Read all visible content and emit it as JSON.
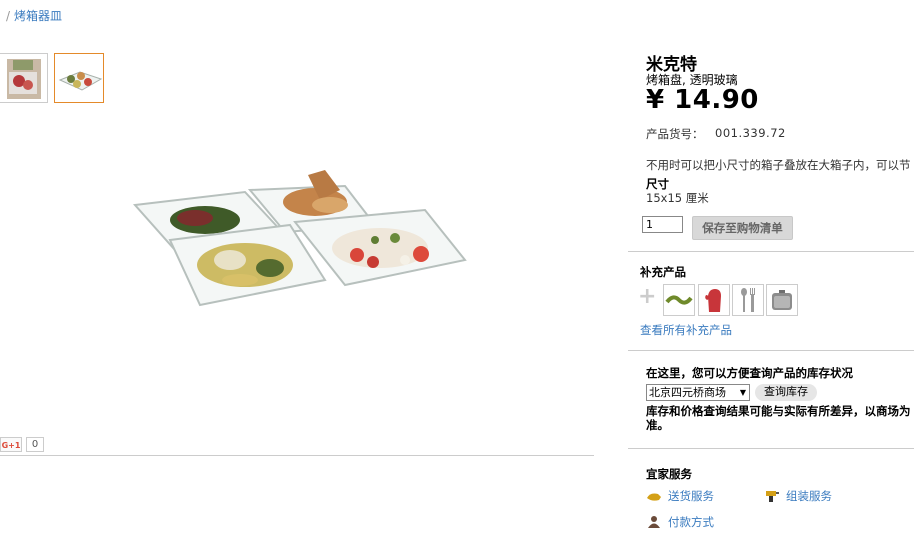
{
  "breadcrumb": {
    "separator": "/",
    "current": "烤箱器皿"
  },
  "social": {
    "gplus_label": "G+1",
    "gplus_count": "0"
  },
  "product": {
    "name": "米克特",
    "subtitle": "烤箱盘, 透明玻璃",
    "price": "¥ 14.90",
    "sku_label": "产品货号：",
    "sku_value": "001.339.72",
    "description": "不用时可以把小尺寸的箱子叠放在大箱子内，可以节",
    "size_label": "尺寸",
    "size_value": "15x15 厘米",
    "quantity": "1",
    "add_to_cart_label": "保存至购物清单"
  },
  "accessories": {
    "title": "补充产品",
    "plus": "+",
    "link": "查看所有补充产品",
    "icons": [
      "green-clip-icon",
      "red-oven-mitt-icon",
      "utensils-icon",
      "silver-pot-icon"
    ]
  },
  "stock": {
    "title": "在这里，您可以方便查询产品的库存状况",
    "store": "北京四元桥商场",
    "check_label": "查询库存",
    "note": "库存和价格查询结果可能与实际有所差异，以商场为准。"
  },
  "services": {
    "title": "宜家服务",
    "items": [
      {
        "label": "送货服务",
        "icon": "truck-icon"
      },
      {
        "label": "组装服务",
        "icon": "drill-icon"
      },
      {
        "label": "付款方式",
        "icon": "payment-icon"
      }
    ]
  },
  "colors": {
    "link": "#3a7bbf",
    "active_thumb": "#e48a2a",
    "button_bg": "#d8d8d8"
  }
}
